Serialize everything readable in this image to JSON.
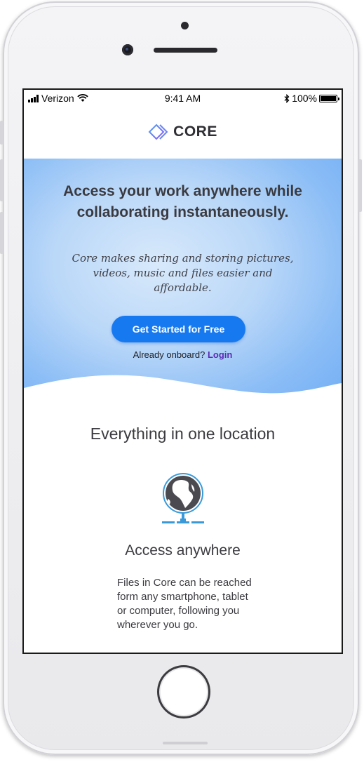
{
  "status_bar": {
    "carrier": "Verizon",
    "time": "9:41 AM",
    "battery": "100%"
  },
  "brand": {
    "name": "CORE",
    "logo_icon": "diamond-logo-icon"
  },
  "hero": {
    "title": "Access your work anywhere while collaborating instantaneously.",
    "subtitle": "Core makes sharing and storing pictures, videos, music and files easier and affordable.",
    "cta_label": "Get Started for Free",
    "onboard_text": "Already onboard?",
    "login_label": "Login"
  },
  "section": {
    "title": "Everything in one location"
  },
  "feature": {
    "icon": "globe-network-icon",
    "title": "Access anywhere",
    "text": "Files in Core can be reached form any smartphone, tablet or computer, following you wherever you go."
  },
  "colors": {
    "accent": "#1779f0",
    "login": "#5b2bb5",
    "hero_gradient_light": "#d8e9fb",
    "hero_gradient_dark": "#7ab3f5"
  }
}
